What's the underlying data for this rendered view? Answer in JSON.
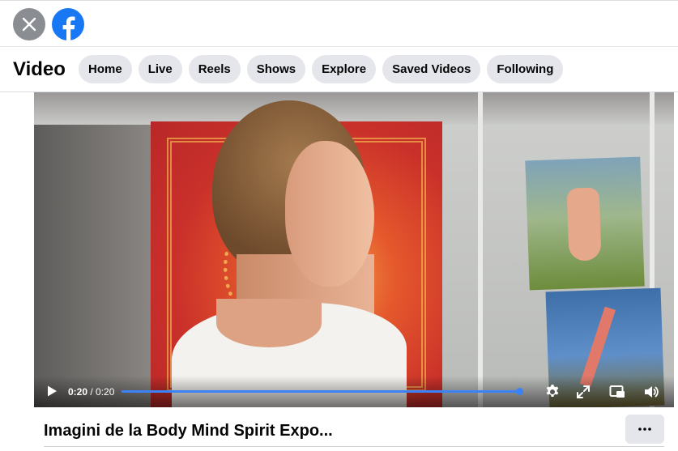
{
  "window": {
    "accent_color": "#1877f2"
  },
  "topbar": {
    "close_icon": "close-icon",
    "logo_icon": "facebook-logo-icon"
  },
  "nav": {
    "title": "Video",
    "tabs": [
      {
        "label": "Home"
      },
      {
        "label": "Live"
      },
      {
        "label": "Reels"
      },
      {
        "label": "Shows"
      },
      {
        "label": "Explore"
      },
      {
        "label": "Saved Videos"
      },
      {
        "label": "Following"
      }
    ]
  },
  "player": {
    "current_time": "0:20",
    "separator": " / ",
    "duration": "0:20",
    "progress": 0.99,
    "progress_color": "#3b82f6",
    "icons": [
      "play-icon",
      "settings-gear-icon",
      "fullscreen-expand-icon",
      "picture-in-picture-icon",
      "volume-icon"
    ]
  },
  "video": {
    "title": "Imagini de la Body Mind Spirit Expo...",
    "more_icon": "more-options-icon"
  }
}
